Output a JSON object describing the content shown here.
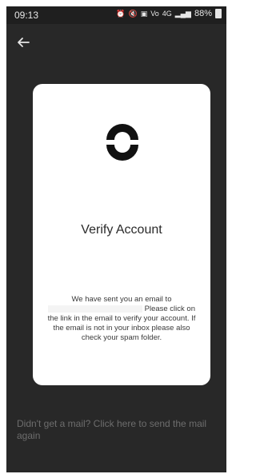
{
  "status_bar": {
    "time": "09:13",
    "indicators": [
      "alarm-icon",
      "mute-icon",
      "photo-icon",
      "volte-icon",
      "4g-icon",
      "signal-icon"
    ],
    "battery": "88%"
  },
  "header": {
    "back_icon": "arrow-left-icon"
  },
  "card": {
    "title": "Verify Account",
    "message_line1": "We have sent you an email to",
    "message_rest": "Please click on the link in the email to verify your account. If the email is not in your inbox please also check your spam folder."
  },
  "footer": {
    "resend_text": "Didn't get a mail? Click here to send the mail again"
  },
  "colors": {
    "background": "#282828",
    "card": "#ffffff",
    "muted_text": "#6d6d6d",
    "logo": "#111111"
  }
}
